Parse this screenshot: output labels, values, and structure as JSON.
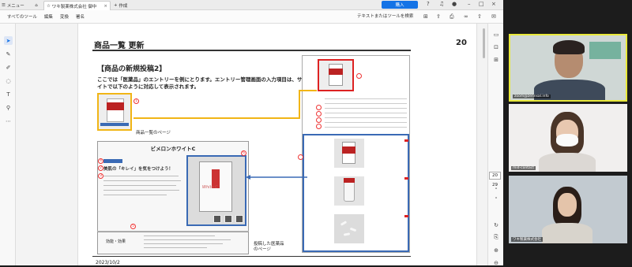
{
  "tabs": {
    "menu": "メニュー",
    "doc": "ワキ製薬株式会社 御中",
    "new": "作成"
  },
  "menubar": {
    "items": [
      "すべてのツール",
      "編集",
      "変換",
      "署名"
    ],
    "search": "テキストまたはツールを検索",
    "buy": "購入"
  },
  "page": {
    "title": "商品一覧 更新",
    "number": "20",
    "date": "2023/10/2",
    "heading": "【商品の新規投稿2】",
    "intro": "ここでは「医薬品」のエントリーを例にとります。エントリー管理画面の入力項目は、サイトで以下のように対応して表示されます。",
    "list_label": "商品一覧のページ",
    "detail_label": "投稿した医薬品のページ",
    "product_title": "ビメロンホワイトC",
    "catch": "美肌の「キレイ」を気をつけよう！",
    "info_label": "効能・効果",
    "pkg_text": "White C",
    "markers": [
      "1",
      "2",
      "3",
      "4",
      "5",
      "6"
    ]
  },
  "viewer": {
    "page_current": "20",
    "page_total": "29"
  },
  "participants": [
    {
      "name": "zoom@zennsal.info"
    },
    {
      "name": "mid-contact"
    },
    {
      "name": "ワキ製薬株式会社"
    }
  ],
  "colors": {
    "accent": "#1473e6",
    "yellow": "#f1b516",
    "blue": "#3a6ab5",
    "red": "#dd2222"
  }
}
